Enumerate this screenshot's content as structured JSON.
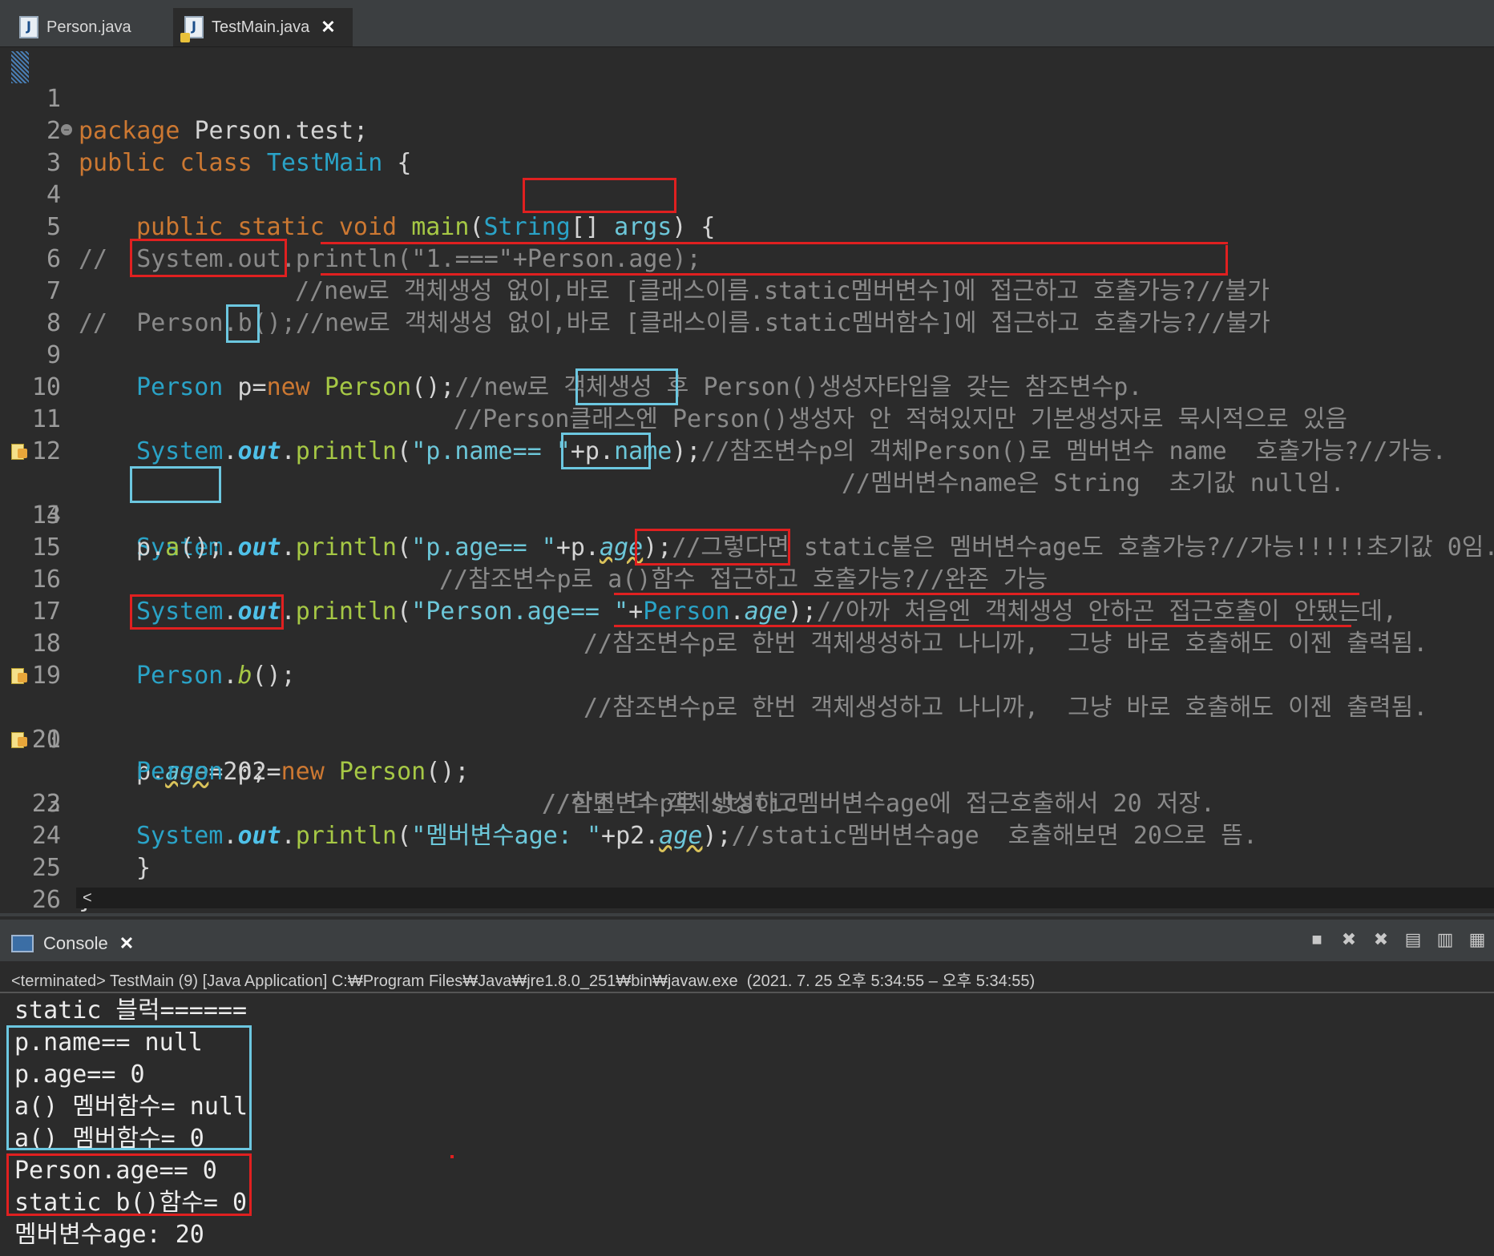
{
  "tabs": [
    {
      "label": "Person.java"
    },
    {
      "label": "TestMain.java"
    }
  ],
  "editor": {
    "line_numbers": [
      "1",
      "2",
      "3",
      "4",
      "5",
      "6",
      "7",
      "8",
      "9",
      "10",
      "11",
      "12",
      "13",
      "14",
      "15",
      "16",
      "17",
      "18",
      "19",
      "20",
      "21",
      "22",
      "23",
      "24",
      "25",
      "26"
    ],
    "lines": {
      "l1": [
        "package",
        " Person.test;"
      ],
      "l2": [
        "public",
        " ",
        "class",
        " ",
        "TestMain",
        " {"
      ],
      "l3": [
        "public",
        " ",
        "static",
        " ",
        "void",
        " ",
        "main",
        "(",
        "String",
        "[] ",
        "args",
        ") {"
      ],
      "l5": [
        "//",
        "  System.out.println(\"1.===\"+Person.age);"
      ],
      "l6": "//new로 객체생성 없이,바로 [클래스이름.static멤버변수]에 접근하고 호출가능?//불가",
      "l7": [
        "//",
        "  Person.b();//new로 객체생성 없이,바로 [클래스이름.static멤버함수]에 접근하고 호출가능?//불가"
      ],
      "l9": [
        "Person",
        " p=",
        "new",
        " ",
        "Person",
        "();",
        "//new로 객체생성 후 Person()생성자타입을 갖는 참조변수p."
      ],
      "l10": "//Person클래스엔 Person()생성자 안 적혀있지만 기본생성자로 묵시적으로 있음",
      "l11": [
        "System",
        ".",
        "out",
        ".",
        "println",
        "(",
        "\"p.name== \"",
        "+p.",
        "name",
        ");",
        "//참조변수p의 객체Person()로 멤버변수 name  호출가능?//가능."
      ],
      "l12": "//멤버변수name은 String  초기값 null임.",
      "l13": [
        "System",
        ".",
        "out",
        ".",
        "println",
        "(",
        "\"p.age== \"",
        "+p.",
        "age",
        ");",
        "//그렇다면 static붙은 멤버변수age도 호출가능?//가능!!!!!초기값 0임."
      ],
      "l14": [
        "p.",
        "a",
        "();",
        "//참조변수p로 a()함수 접근하고 호출가능?//완존 가능"
      ],
      "l16": [
        "System",
        ".",
        "out",
        ".",
        "println",
        "(",
        "\"Person.age== \"",
        "+",
        "Person",
        ".",
        "age",
        ");",
        "//아까 처음엔 객체생성 안하곤 접근호출이 안됐는데,"
      ],
      "l17": "//참조변수p로 한번 객체생성하고 나니까,  그냥 바로 호출해도 이젠 출력됨.",
      "l18": [
        "Person",
        ".",
        "b",
        "();",
        "//참조변수p로 한번 객체생성하고 나니까,  그냥 바로 호출해도 이젠 출력됨."
      ],
      "l20": [
        "p.",
        "age",
        "=20;",
        "//참조변수p로 static멤버변수age에 접근호출해서 20 저장."
      ],
      "l21": [
        "Person",
        " p2=",
        "new",
        " ",
        "Person",
        "();",
        "//한번 더 객체생성하고"
      ],
      "l22": [
        "System",
        ".",
        "out",
        ".",
        "println",
        "(",
        "\"멤버변수age: \"",
        "+p2.",
        "age",
        ");",
        "//static멤버변수age  호출해보면 20으로 뜸."
      ],
      "l24": "}",
      "l25": "}"
    }
  },
  "hscroll_glyph": "<",
  "console": {
    "tab_label": "Console",
    "info": "<terminated> TestMain (9) [Java Application] C:₩Program Files₩Java₩jre1.8.0_251₩bin₩javaw.exe  (2021. 7. 25 오후 5:34:55 – 오후 5:34:55)",
    "output": [
      "static 블럭======",
      "p.name== null",
      "p.age== 0",
      "a() 멤버함수= null",
      "a() 멤버함수= 0",
      "Person.age== 0",
      "static b()함수= 0",
      "멤버변수age: 20"
    ]
  },
  "icons": {
    "close_tab": "close-icon",
    "java_file": "java-file-icon",
    "console": "console-icon"
  },
  "colors": {
    "keyword": "#cc7832",
    "type": "#2aa3c7",
    "method": "#a6c845",
    "string": "#6cc7d9",
    "comment": "#8a8a8a",
    "annotation_red": "#e02020",
    "annotation_cyan": "#6cc7e0"
  }
}
